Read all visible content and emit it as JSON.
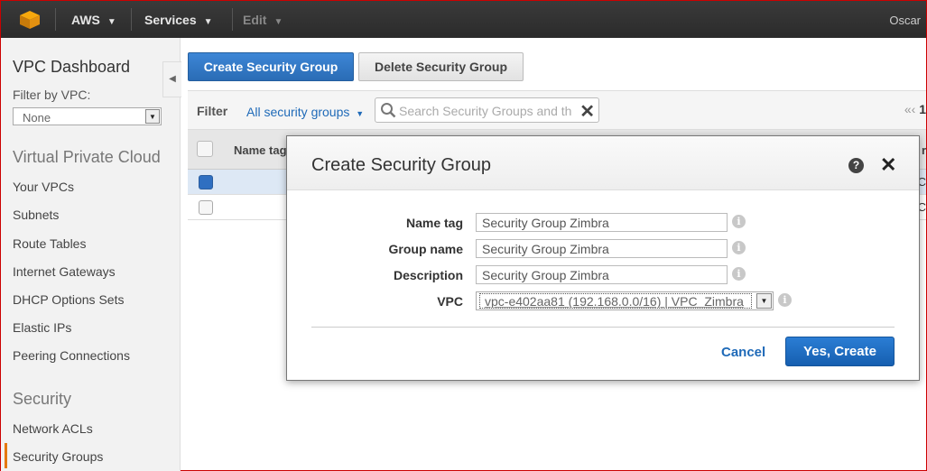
{
  "topbar": {
    "brand": "AWS",
    "services": "Services",
    "edit": "Edit",
    "caret": "▼",
    "user": "Oscar"
  },
  "sidebar": {
    "title": "VPC Dashboard",
    "filter_label": "Filter by VPC:",
    "filter_value": "None",
    "sections": [
      {
        "label": "Virtual Private Cloud",
        "items": [
          "Your VPCs",
          "Subnets",
          "Route Tables",
          "Internet Gateways",
          "DHCP Options Sets",
          "Elastic IPs",
          "Peering Connections"
        ]
      },
      {
        "label": "Security",
        "items": [
          "Network ACLs",
          "Security Groups"
        ]
      }
    ],
    "active_item": "Security Groups"
  },
  "toolbar": {
    "create_label": "Create Security Group",
    "delete_label": "Delete Security Group"
  },
  "filterbar": {
    "label": "Filter",
    "dropdown": "All security groups",
    "search_placeholder": "Search Security Groups and th",
    "pager_prefix": "«‹",
    "pager_page": "1"
  },
  "table": {
    "columns": [
      "Name tag"
    ],
    "rows": [
      {
        "selected": true,
        "edge": "C"
      },
      {
        "selected": false,
        "edge": "C"
      }
    ],
    "edge_header": "r"
  },
  "modal": {
    "title": "Create Security Group",
    "fields": [
      {
        "label": "Name tag",
        "value": "Security Group Zimbra"
      },
      {
        "label": "Group name",
        "value": "Security Group Zimbra"
      },
      {
        "label": "Description",
        "value": "Security Group Zimbra"
      }
    ],
    "vpc": {
      "label": "VPC",
      "value": "vpc-e402aa81 (192.168.0.0/16) | VPC_Zimbra"
    },
    "cancel_label": "Cancel",
    "create_label": "Yes, Create"
  },
  "colors": {
    "topbar": "#2b2b2b",
    "primary": "#2a6cb5",
    "link": "#1f6ab8",
    "active_accent": "#e47911"
  }
}
